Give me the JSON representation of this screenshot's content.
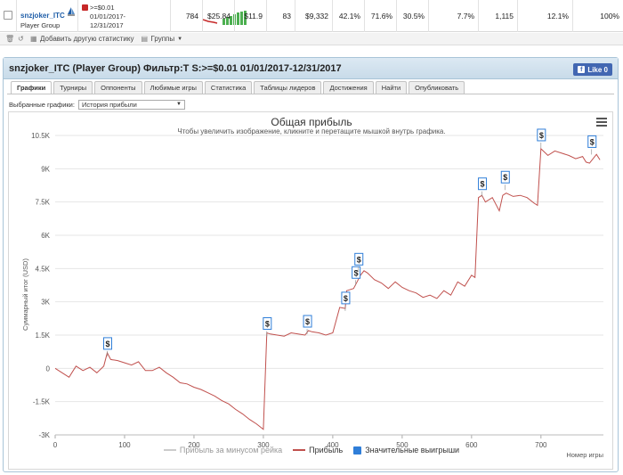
{
  "player": {
    "name": "snzjoker_ITC",
    "type": "Player Group",
    "filter_line1": ">=$0.01",
    "filter_line2": "01/01/2017-",
    "filter_line3": "12/31/2017"
  },
  "stats": [
    "784",
    "$25.84",
    "$11.9",
    "83",
    "$9,332",
    "42.1%",
    "71.6%",
    "30.5%",
    "7.7%",
    "1,115",
    "12.1%",
    "100%"
  ],
  "toolbar": {
    "add_stat": "Добавить другую статистику",
    "groups": "Группы"
  },
  "panel": {
    "title": "snzjoker_ITC (Player Group) Фильтр:T S:>=$0.01 01/01/2017-12/31/2017",
    "fb_like": "Like 0"
  },
  "tabs": [
    "Графики",
    "Турниры",
    "Оппоненты",
    "Любимые игры",
    "Статистика",
    "Таблицы лидеров",
    "Достижения",
    "Найти",
    "Опубликовать"
  ],
  "select": {
    "label": "Выбранные графики:",
    "value": "История прибыли"
  },
  "colors": {
    "profit_line": "#c0504d",
    "rake_line": "#cccccc",
    "wins_box": "#2f7ed8",
    "accent": "#1f5ea8"
  },
  "chart_data": {
    "type": "line",
    "title": "Общая прибыль",
    "subtitle": "Чтобы увеличить изображение, кликните и перетащите мышкой внутрь графика.",
    "xlabel": "Номер игры",
    "ylabel": "Суммарный итог (USD)",
    "xlim": [
      0,
      790
    ],
    "ylim": [
      -3000,
      10500
    ],
    "x_ticks": [
      0,
      100,
      200,
      300,
      400,
      500,
      600,
      700
    ],
    "y_ticks": [
      -3000,
      -1500,
      0,
      1500,
      3000,
      4500,
      6000,
      7500,
      9000,
      10500
    ],
    "y_tick_labels": [
      "-3K",
      "-1.5K",
      "0",
      "1.5K",
      "3K",
      "4.5K",
      "6K",
      "7.5K",
      "9K",
      "10.5K"
    ],
    "legend": [
      "Прибыль за минусом рейка",
      "Прибыль",
      "Значительные выигрыши"
    ],
    "grid": true,
    "series": [
      {
        "name": "Прибыль",
        "x": [
          0,
          10,
          20,
          30,
          40,
          50,
          60,
          70,
          75,
          80,
          90,
          100,
          110,
          120,
          130,
          140,
          150,
          160,
          170,
          180,
          190,
          200,
          210,
          220,
          230,
          240,
          250,
          260,
          270,
          280,
          290,
          300,
          305,
          310,
          320,
          330,
          340,
          350,
          360,
          365,
          370,
          380,
          390,
          400,
          410,
          418,
          420,
          430,
          435,
          440,
          445,
          450,
          460,
          470,
          480,
          490,
          500,
          510,
          520,
          530,
          540,
          550,
          560,
          570,
          580,
          590,
          600,
          605,
          610,
          615,
          620,
          630,
          640,
          645,
          650,
          660,
          670,
          680,
          690,
          695,
          700,
          710,
          720,
          730,
          740,
          750,
          760,
          765,
          770,
          780,
          785
        ],
        "y": [
          0,
          -200,
          -400,
          100,
          -100,
          50,
          -200,
          100,
          700,
          400,
          350,
          250,
          150,
          300,
          -100,
          -100,
          50,
          -200,
          -400,
          -650,
          -700,
          -850,
          -950,
          -1100,
          -1250,
          -1450,
          -1600,
          -1850,
          -2050,
          -2300,
          -2500,
          -2750,
          1600,
          1550,
          1500,
          1450,
          1600,
          1550,
          1500,
          1700,
          1650,
          1600,
          1500,
          1600,
          2750,
          2700,
          3500,
          3600,
          3900,
          4200,
          4400,
          4300,
          4000,
          3850,
          3600,
          3900,
          3650,
          3500,
          3400,
          3200,
          3300,
          3150,
          3500,
          3300,
          3900,
          3700,
          4200,
          4100,
          7700,
          7800,
          7500,
          7700,
          7100,
          7800,
          7900,
          7750,
          7800,
          7700,
          7450,
          7350,
          9900,
          9600,
          9800,
          9700,
          9600,
          9450,
          9550,
          9300,
          9250,
          9650,
          9400
        ]
      },
      {
        "name": "Значительные выигрыши",
        "x": [
          75,
          305,
          363,
          418,
          433,
          437,
          615,
          648,
          700,
          773
        ],
        "y": [
          700,
          1600,
          1700,
          2750,
          3900,
          4500,
          7900,
          8200,
          10100,
          9800
        ]
      }
    ]
  }
}
